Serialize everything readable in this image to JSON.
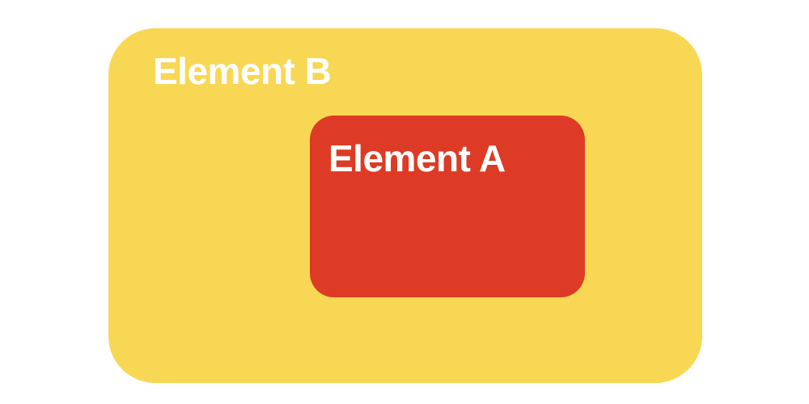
{
  "outer_box": {
    "label": "Element B",
    "color": "#F8D754"
  },
  "inner_box": {
    "label": "Element A",
    "color": "#DD3B25"
  }
}
